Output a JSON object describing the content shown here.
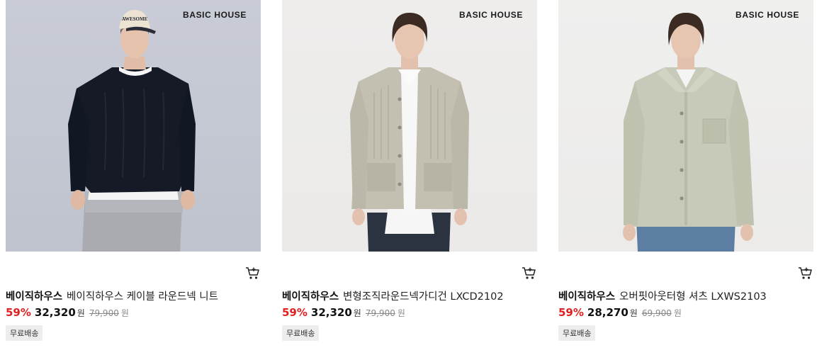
{
  "products": [
    {
      "image_brand": "BASIC HOUSE",
      "cap_text": "AWESOME",
      "brand": "베이직하우스",
      "name": "베이직하우스 케이블 라운드넥 니트",
      "discount": "59%",
      "price": "32,320",
      "currency": "원",
      "original_price": "79,900",
      "original_currency": "원",
      "badge": "무료배송",
      "icon": "cart-icon"
    },
    {
      "image_brand": "BASIC HOUSE",
      "brand": "베이직하우스",
      "name": "변형조직라운드넥가디건 LXCD2102",
      "discount": "59%",
      "price": "32,320",
      "currency": "원",
      "original_price": "79,900",
      "original_currency": "원",
      "badge": "무료배송",
      "icon": "cart-icon"
    },
    {
      "image_brand": "BASIC HOUSE",
      "brand": "베이직하우스",
      "name": "오버핏아웃터형 셔츠 LXWS2103",
      "discount": "59%",
      "price": "28,270",
      "currency": "원",
      "original_price": "69,900",
      "original_currency": "원",
      "badge": "무료배송",
      "icon": "cart-icon"
    }
  ],
  "colors": {
    "discount": "#e0201f",
    "badge_bg": "#ededed",
    "strike_text": "#888888"
  }
}
